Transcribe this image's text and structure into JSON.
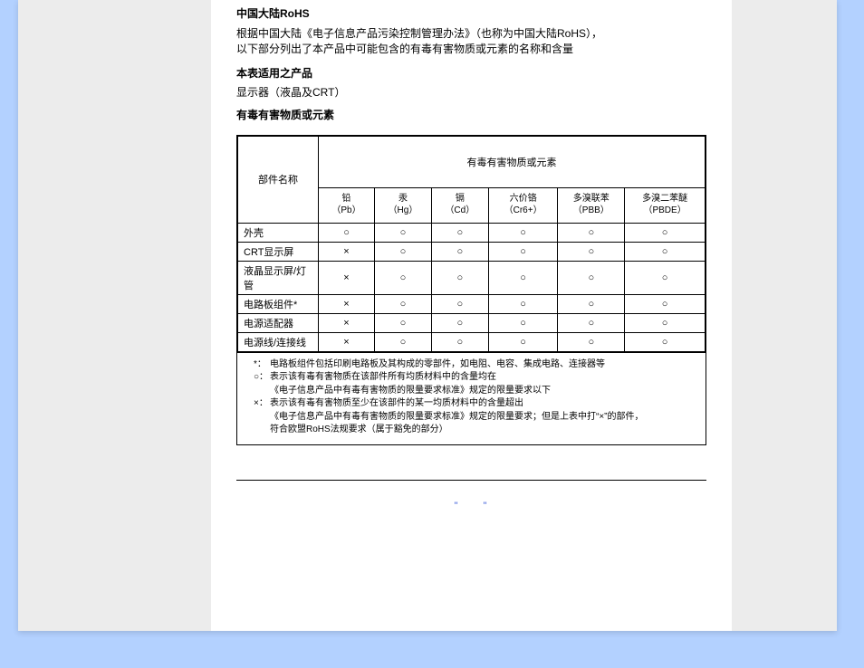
{
  "title": "中国大陆RoHS",
  "intro_l1": "根据中国大陆《电子信息产品污染控制管理办法》（也称为中国大陆RoHS），",
  "intro_l2": "以下部分列出了本产品中可能包含的有毒有害物质或元素的名称和含量",
  "section_product_title": "本表适用之产品",
  "section_product_value": "显示器（液晶及CRT）",
  "section_substances_title": "有毒有害物质或元素",
  "table": {
    "corner": "部件名称",
    "group_header": "有毒有害物质或元素",
    "columns": [
      {
        "top": "铅",
        "sub": "（Pb）"
      },
      {
        "top": "汞",
        "sub": "（Hg）"
      },
      {
        "top": "镉",
        "sub": "（Cd）"
      },
      {
        "top": "六价铬",
        "sub": "（Cr6+）"
      },
      {
        "top": "多溴联苯",
        "sub": "（PBB）"
      },
      {
        "top": "多溴二苯醚",
        "sub": "（PBDE）"
      }
    ],
    "rows": [
      {
        "name": "外壳",
        "vals": [
          "○",
          "○",
          "○",
          "○",
          "○",
          "○"
        ]
      },
      {
        "name": "CRT显示屏",
        "vals": [
          "×",
          "○",
          "○",
          "○",
          "○",
          "○"
        ]
      },
      {
        "name": "液晶显示屏/灯管",
        "vals": [
          "×",
          "○",
          "○",
          "○",
          "○",
          "○"
        ]
      },
      {
        "name": "电路板组件*",
        "vals": [
          "×",
          "○",
          "○",
          "○",
          "○",
          "○"
        ]
      },
      {
        "name": "电源适配器",
        "vals": [
          "×",
          "○",
          "○",
          "○",
          "○",
          "○"
        ]
      },
      {
        "name": "电源线/连接线",
        "vals": [
          "×",
          "○",
          "○",
          "○",
          "○",
          "○"
        ]
      }
    ]
  },
  "notes": {
    "star": {
      "mark": "*：",
      "text": "电路板组件包括印刷电路板及其构成的零部件，如电阻、电容、集成电路、连接器等"
    },
    "circle": {
      "mark": "○：",
      "l1": "表示该有毒有害物质在该部件所有均质材料中的含量均在",
      "l2": "《电子信息产品中有毒有害物质的限量要求标准》规定的限量要求以下"
    },
    "cross": {
      "mark": "×：",
      "l1": "表示该有毒有害物质至少在该部件的某一均质材料中的含量超出",
      "l2": "《电子信息产品中有毒有害物质的限量要求标准》规定的限量要求；但是上表中打“×”的部件，",
      "l3": "符合欧盟RoHS法规要求（属于豁免的部分）"
    }
  },
  "footer_link": "\"  \""
}
